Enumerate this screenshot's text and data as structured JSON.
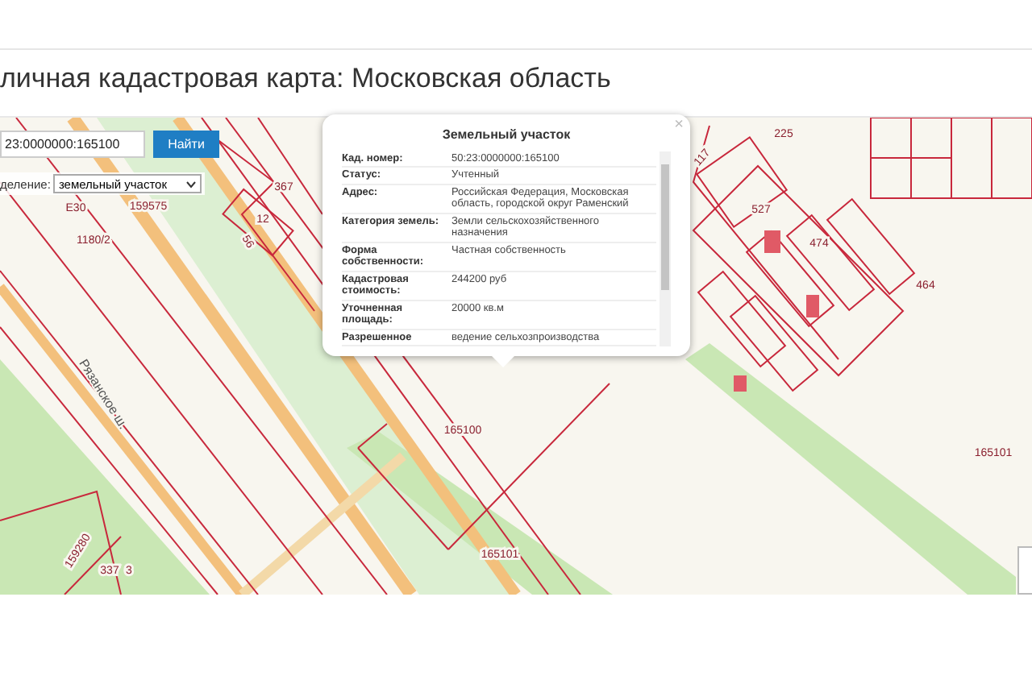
{
  "page_title": "личная кадастровая карта: Московская область",
  "search": {
    "value": "23:0000000:165100",
    "button": "Найти"
  },
  "filter": {
    "label": "деление:",
    "value": "земельный участок"
  },
  "popup": {
    "title": "Земельный участок",
    "close": "×",
    "rows": [
      {
        "label": "Кад. номер:",
        "value": "50:23:0000000:165100"
      },
      {
        "label": "Статус:",
        "value": "Учтенный"
      },
      {
        "label": "Адрес:",
        "value": "Российская Федерация, Московская область, городской округ Раменский"
      },
      {
        "label": "Категория земель:",
        "value": "Земли сельскохозяйственного назначения"
      },
      {
        "label": "Форма собственности:",
        "value": "Частная собственность"
      },
      {
        "label": "Кадастровая стоимость:",
        "value": "244200 руб"
      },
      {
        "label": "Уточненная площадь:",
        "value": "20000 кв.м"
      },
      {
        "label": "Разрешенное",
        "value": "ведение сельхозпроизводства"
      }
    ]
  },
  "map_labels": [
    "165100",
    "165101",
    "165101",
    "1180/2",
    "Рязанское ш.",
    "E30",
    "159575",
    "367",
    "12",
    "56",
    "337",
    "3",
    "159280",
    "527",
    "474",
    "225",
    "464",
    "117"
  ]
}
